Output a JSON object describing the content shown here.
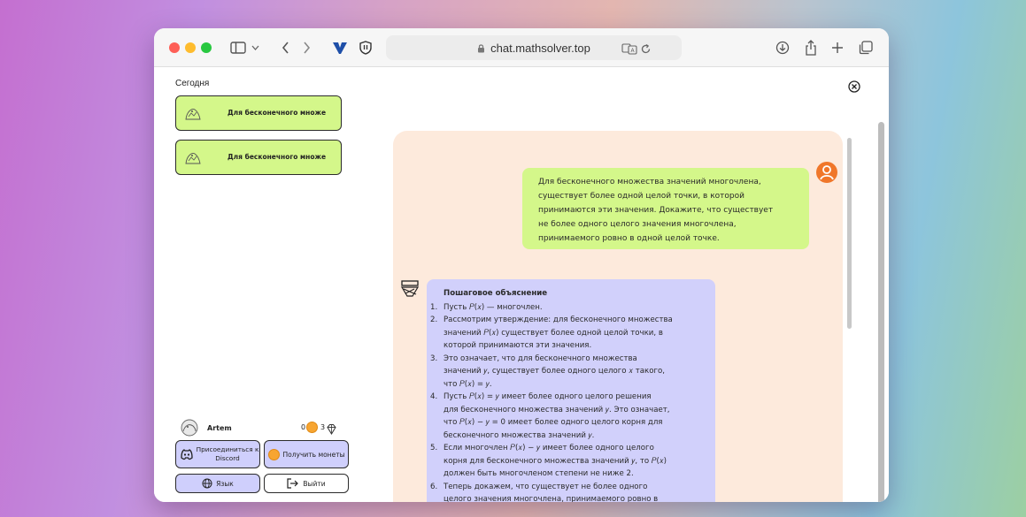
{
  "browser": {
    "url": "chat.mathsolver.top",
    "icons": [
      "sidebar-icon",
      "chevron-down-icon",
      "back-icon",
      "forward-icon",
      "vpn-icon",
      "shield-icon",
      "lock-icon",
      "translate-icon",
      "reload-icon",
      "download-icon",
      "share-icon",
      "new-tab-icon",
      "tabs-icon"
    ]
  },
  "sidebar": {
    "section_title": "Сегодня",
    "chats": [
      {
        "label": "Для бесконечного множе"
      },
      {
        "label": "Для бесконечного множе"
      }
    ],
    "user": {
      "name": "Artem",
      "coins": "0",
      "gems": "3"
    },
    "buttons": {
      "discord_line1": "Присоединиться к",
      "discord_line2": "Discord",
      "get_coins": "Получить монеты",
      "language": "Язык",
      "logout": "Выйти"
    }
  },
  "chat": {
    "user_message": [
      "Для бесконечного множества значений многочлена,",
      "существует более одной целой точки, в которой",
      "принимаются эти значения. Докажите, что существует",
      "не более одного целого значения многочлена,",
      "принимаемого ровно в одной целой точке."
    ],
    "bot_title": "Пошаговое объяснение",
    "bot_steps": [
      {
        "n": "1.",
        "lines": [
          "Пусть 𝑃(𝑥) — многочлен."
        ]
      },
      {
        "n": "2.",
        "lines": [
          "Рассмотрим утверждение: для бесконечного множества",
          "значений 𝑃(𝑥) существует более одной целой точки, в",
          "которой принимаются эти значения."
        ]
      },
      {
        "n": "3.",
        "lines": [
          "Это означает, что для бесконечного множества",
          "значений 𝑦, существует более одного целого 𝑥 такого,",
          "что 𝑃(𝑥) = 𝑦."
        ]
      },
      {
        "n": "4.",
        "lines": [
          "Пусть 𝑃(𝑥) = 𝑦 имеет более одного целого решения",
          "для бесконечного множества значений 𝑦. Это означает,",
          "что 𝑃(𝑥) − 𝑦 = 0 имеет более одного целого корня для",
          "бесконечного множества значений 𝑦."
        ]
      },
      {
        "n": "5.",
        "lines": [
          "Если многочлен 𝑃(𝑥) − 𝑦 имеет более одного целого",
          "корня для бесконечного множества значений 𝑦, то 𝑃(𝑥)",
          "должен быть многочленом степени не ниже 2."
        ]
      },
      {
        "n": "6.",
        "lines": [
          "Теперь докажем, что существует не более одного",
          "целого значения многочлена, принимаемого ровно в"
        ]
      }
    ]
  }
}
